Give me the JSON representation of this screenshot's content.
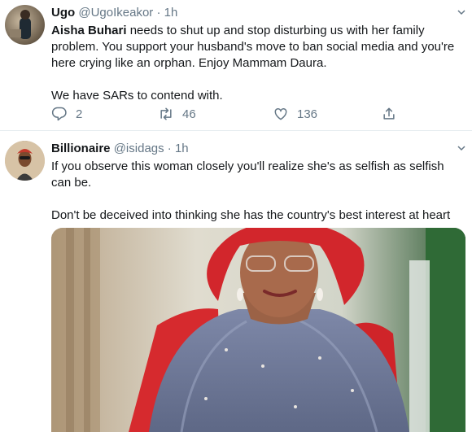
{
  "tweets": [
    {
      "author_name": "Ugo",
      "handle": "@UgoIkeakor",
      "separator": "·",
      "time": "1h",
      "mention": "Aisha Buhari",
      "text_rest": " needs to shut up and stop disturbing us with her family problem. You support your husband's move to ban social media and you're here crying like an orphan. Enjoy Mammam Daura.",
      "text_p2": "We have SARs to contend with.",
      "reply_count": "2",
      "retweet_count": "46",
      "like_count": "136",
      "icons": [
        "reply-icon",
        "retweet-icon",
        "like-icon",
        "share-icon",
        "chevron-down-icon"
      ]
    },
    {
      "author_name": "Billionaire",
      "handle": "@isidags",
      "separator": "·",
      "time": "1h",
      "text_p1": "If you observe this woman closely you'll realize she's as selfish as selfish can be.",
      "text_p2": "Don't be deceived into thinking she has the country's best interest at heart"
    }
  ],
  "colors": {
    "text": "#14171a",
    "secondary": "#657786",
    "divider": "#e6ecf0",
    "headwrap": "#d2262c",
    "dress": "#6f7a99"
  }
}
